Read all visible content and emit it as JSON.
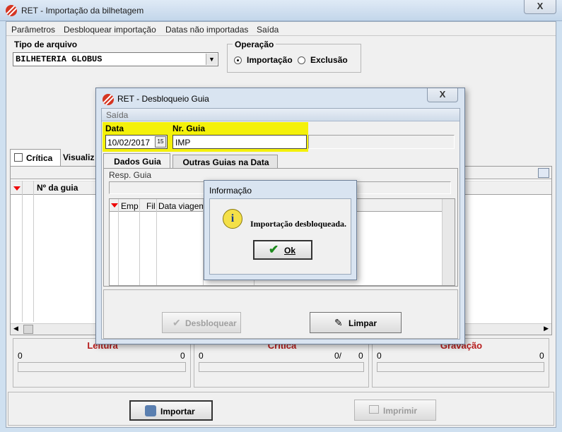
{
  "window": {
    "title": "RET - Importação da bilhetagem",
    "close": "X"
  },
  "menu": [
    "Parâmetros",
    "Desbloquear importação",
    "Datas não importadas",
    "Saída"
  ],
  "tipo_arquivo": {
    "label": "Tipo de arquivo",
    "value": "BILHETERIA GLOBUS"
  },
  "operacao": {
    "label": "Operação",
    "options": [
      "Importação",
      "Exclusão"
    ],
    "selected": "Importação"
  },
  "main_tabs": [
    "Crítica",
    "Visualiz"
  ],
  "main_grid": {
    "col_guia": "Nº da guia"
  },
  "stats": [
    {
      "title": "Leitura",
      "left": "0",
      "right": "0"
    },
    {
      "title": "Crítica",
      "left": "0",
      "right": "0/",
      "right2": "0"
    },
    {
      "title": "Gravação",
      "left": "0",
      "right": "0"
    }
  ],
  "buttons": {
    "importar": "Importar",
    "imprimir": "Imprimir"
  },
  "dialog": {
    "title": "RET - Desbloqueio Guia",
    "menu": "Saída",
    "data_label": "Data",
    "data_value": "10/02/2017",
    "calendar": "15",
    "guia_label": "Nr. Guia",
    "guia_value": "IMP",
    "tabs": [
      "Dados Guia",
      "Outras Guias na Data"
    ],
    "resp_label": "Resp. Guia",
    "grid_cols": [
      "Emp",
      "Fil",
      "Data viagem"
    ],
    "btn_desbloquear": "Desbloquear",
    "btn_limpar": "Limpar"
  },
  "info": {
    "title": "Informação",
    "message": "Importação desbloqueada.",
    "ok": "Ok",
    "icon_glyph": "i"
  }
}
